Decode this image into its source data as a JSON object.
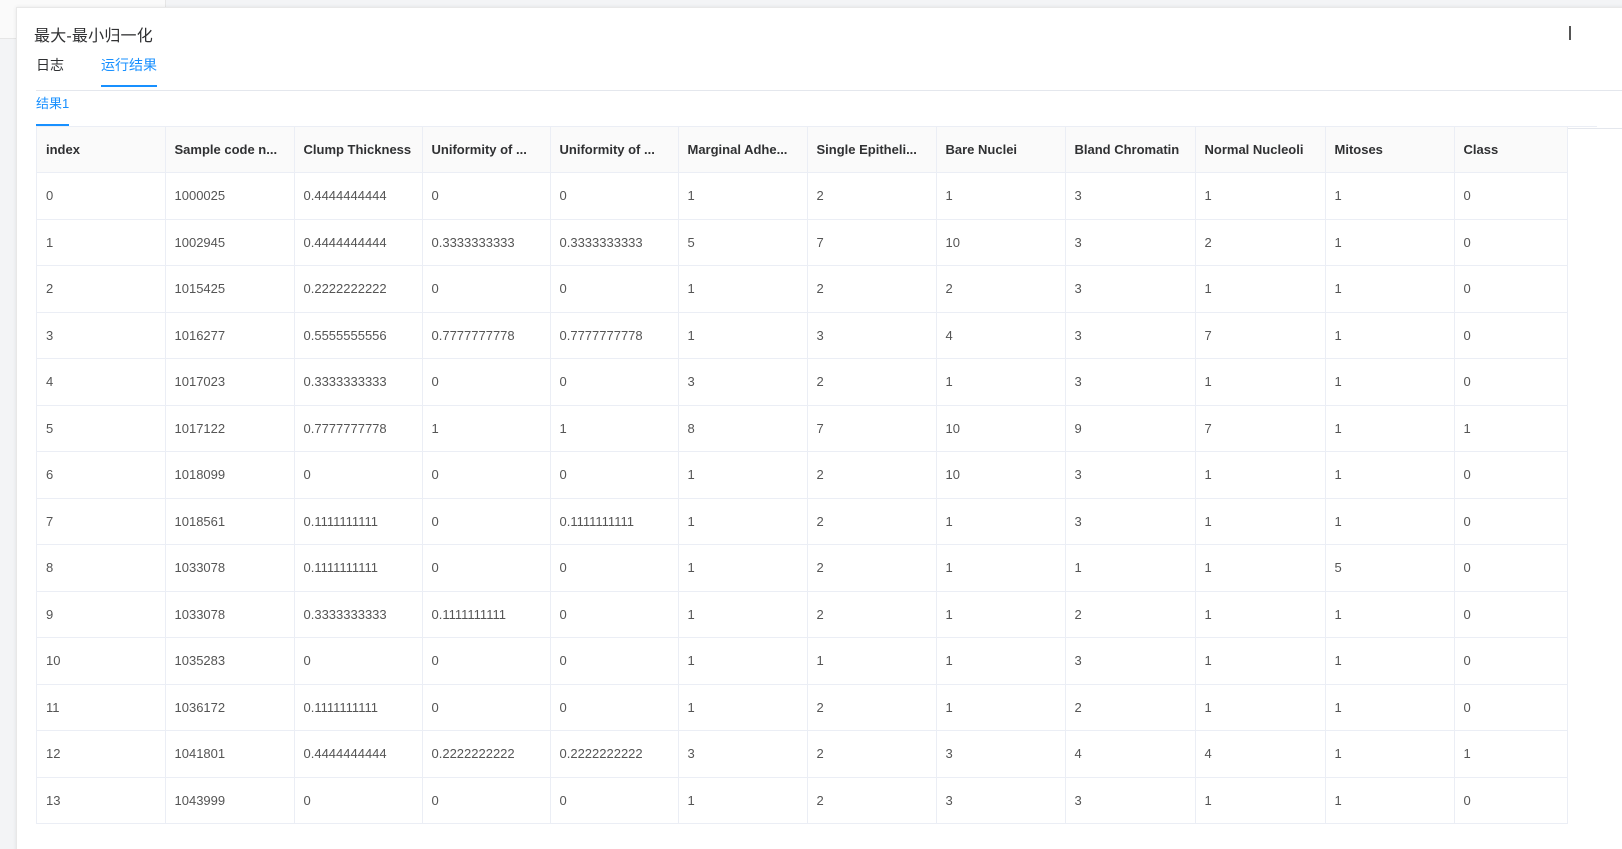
{
  "dialog": {
    "title": "最大-最小归一化"
  },
  "tabs": {
    "log_label": "日志",
    "result_label": "运行结果",
    "active": "运行结果"
  },
  "sub_tabs": {
    "result1_label": "结果1"
  },
  "table": {
    "columns": [
      "index",
      "Sample code n...",
      "Clump Thickness",
      "Uniformity of ...",
      "Uniformity of ...",
      "Marginal Adhe...",
      "Single Epitheli...",
      "Bare Nuclei",
      "Bland Chromatin",
      "Normal Nucleoli",
      "Mitoses",
      "Class"
    ],
    "rows": [
      [
        "0",
        "1000025",
        "0.4444444444",
        "0",
        "0",
        "1",
        "2",
        "1",
        "3",
        "1",
        "1",
        "0"
      ],
      [
        "1",
        "1002945",
        "0.4444444444",
        "0.3333333333",
        "0.3333333333",
        "5",
        "7",
        "10",
        "3",
        "2",
        "1",
        "0"
      ],
      [
        "2",
        "1015425",
        "0.2222222222",
        "0",
        "0",
        "1",
        "2",
        "2",
        "3",
        "1",
        "1",
        "0"
      ],
      [
        "3",
        "1016277",
        "0.5555555556",
        "0.7777777778",
        "0.7777777778",
        "1",
        "3",
        "4",
        "3",
        "7",
        "1",
        "0"
      ],
      [
        "4",
        "1017023",
        "0.3333333333",
        "0",
        "0",
        "3",
        "2",
        "1",
        "3",
        "1",
        "1",
        "0"
      ],
      [
        "5",
        "1017122",
        "0.7777777778",
        "1",
        "1",
        "8",
        "7",
        "10",
        "9",
        "7",
        "1",
        "1"
      ],
      [
        "6",
        "1018099",
        "0",
        "0",
        "0",
        "1",
        "2",
        "10",
        "3",
        "1",
        "1",
        "0"
      ],
      [
        "7",
        "1018561",
        "0.1111111111",
        "0",
        "0.1111111111",
        "1",
        "2",
        "1",
        "3",
        "1",
        "1",
        "0"
      ],
      [
        "8",
        "1033078",
        "0.1111111111",
        "0",
        "0",
        "1",
        "2",
        "1",
        "1",
        "1",
        "5",
        "0"
      ],
      [
        "9",
        "1033078",
        "0.3333333333",
        "0.1111111111",
        "0",
        "1",
        "2",
        "1",
        "2",
        "1",
        "1",
        "0"
      ],
      [
        "10",
        "1035283",
        "0",
        "0",
        "0",
        "1",
        "1",
        "1",
        "3",
        "1",
        "1",
        "0"
      ],
      [
        "11",
        "1036172",
        "0.1111111111",
        "0",
        "0",
        "1",
        "2",
        "1",
        "2",
        "1",
        "1",
        "0"
      ],
      [
        "12",
        "1041801",
        "0.4444444444",
        "0.2222222222",
        "0.2222222222",
        "3",
        "2",
        "3",
        "4",
        "4",
        "1",
        "1"
      ],
      [
        "13",
        "1043999",
        "0",
        "0",
        "0",
        "1",
        "2",
        "3",
        "3",
        "1",
        "1",
        "0"
      ]
    ]
  },
  "colors": {
    "accent": "#1890ff",
    "header_bg": "#fafafa",
    "border": "#ebeef5"
  }
}
